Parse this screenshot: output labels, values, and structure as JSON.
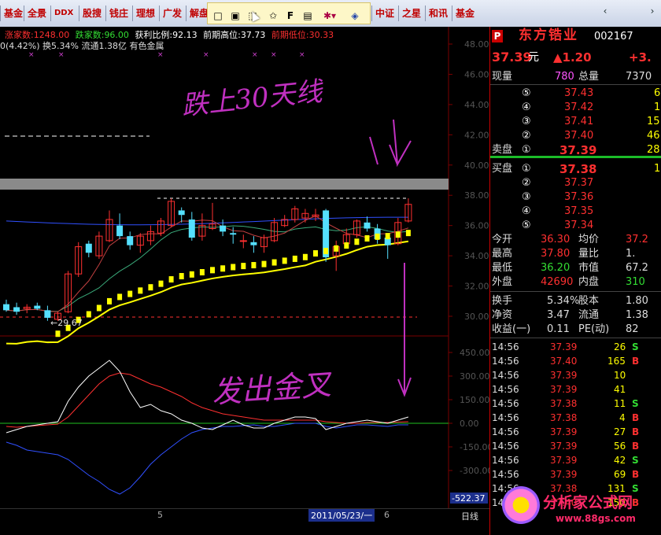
{
  "toolbar": {
    "tabs": [
      "基金",
      "全景",
      "DDX",
      "股搜",
      "钱庄",
      "理想",
      "广发",
      "解盘",
      "中证",
      "之星",
      "和讯",
      "基金"
    ]
  },
  "stats": {
    "up_count_label": "涨家数:",
    "up_count": "1248.00",
    "down_count_label": "跌家数:",
    "down_count": "96.00",
    "profit_ratio_label": "获利比例:",
    "profit_ratio": "92.13",
    "prev_high_label": "前期高位:",
    "prev_high": "37.73",
    "prev_low_label": "前期低位:",
    "prev_low": "30.33",
    "line2": "0(4.42%) 换5.34% 流通1.38亿 有色金属"
  },
  "chart": {
    "price_ticks": [
      "48.00",
      "46.00",
      "44.00",
      "42.00",
      "40.00",
      "38.00",
      "36.00",
      "34.00",
      "32.00",
      "30.00"
    ],
    "indicator_ticks": [
      "450.00",
      "300.00",
      "150.00",
      "0.00",
      "-150.00",
      "-300.00"
    ],
    "low_marker": "←29.67",
    "bottom_value": "-522.37",
    "date_label": "2011/05/23/一",
    "day_line": "日线",
    "month_marks": [
      "5",
      "6"
    ],
    "handwriting_top": "跌上30天线",
    "handwriting_bottom": "发出金叉",
    "colors": {
      "up": "#ff3030",
      "down": "#55e0ff",
      "ma_yellow": "#ffff00"
    }
  },
  "chart_data": {
    "type": "candlestick",
    "candles": [
      {
        "o": 30.8,
        "h": 31.1,
        "l": 30.3,
        "c": 30.4
      },
      {
        "o": 30.6,
        "h": 30.9,
        "l": 30.1,
        "c": 30.3
      },
      {
        "o": 30.5,
        "h": 30.8,
        "l": 30.2,
        "c": 30.6
      },
      {
        "o": 30.7,
        "h": 30.9,
        "l": 30.4,
        "c": 30.5
      },
      {
        "o": 30.4,
        "h": 30.7,
        "l": 29.7,
        "c": 29.9
      },
      {
        "o": 29.8,
        "h": 30.3,
        "l": 29.7,
        "c": 30.2
      },
      {
        "o": 30.3,
        "h": 33.0,
        "l": 30.2,
        "c": 32.8
      },
      {
        "o": 32.8,
        "h": 34.9,
        "l": 32.6,
        "c": 34.6
      },
      {
        "o": 34.8,
        "h": 35.0,
        "l": 33.9,
        "c": 34.2
      },
      {
        "o": 34.0,
        "h": 35.6,
        "l": 33.8,
        "c": 35.3
      },
      {
        "o": 35.0,
        "h": 37.0,
        "l": 34.9,
        "c": 36.4
      },
      {
        "o": 36.0,
        "h": 36.8,
        "l": 35.1,
        "c": 35.3
      },
      {
        "o": 35.3,
        "h": 35.6,
        "l": 34.4,
        "c": 34.7
      },
      {
        "o": 34.7,
        "h": 35.5,
        "l": 34.2,
        "c": 35.3
      },
      {
        "o": 35.0,
        "h": 36.0,
        "l": 34.7,
        "c": 35.6
      },
      {
        "o": 35.5,
        "h": 36.5,
        "l": 35.3,
        "c": 36.3
      },
      {
        "o": 36.0,
        "h": 37.8,
        "l": 35.9,
        "c": 37.6
      },
      {
        "o": 37.0,
        "h": 37.2,
        "l": 36.2,
        "c": 36.7
      },
      {
        "o": 36.4,
        "h": 36.9,
        "l": 35.0,
        "c": 35.2
      },
      {
        "o": 35.3,
        "h": 36.8,
        "l": 35.0,
        "c": 36.0
      },
      {
        "o": 35.8,
        "h": 37.5,
        "l": 35.7,
        "c": 36.1
      },
      {
        "o": 36.0,
        "h": 36.4,
        "l": 35.3,
        "c": 35.6
      },
      {
        "o": 35.5,
        "h": 35.9,
        "l": 34.8,
        "c": 35.4
      },
      {
        "o": 35.0,
        "h": 35.4,
        "l": 34.5,
        "c": 35.0
      },
      {
        "o": 34.9,
        "h": 35.3,
        "l": 34.2,
        "c": 34.7
      },
      {
        "o": 34.6,
        "h": 35.4,
        "l": 34.2,
        "c": 35.2
      },
      {
        "o": 35.0,
        "h": 36.5,
        "l": 34.9,
        "c": 36.2
      },
      {
        "o": 36.0,
        "h": 36.7,
        "l": 35.9,
        "c": 36.4
      },
      {
        "o": 36.4,
        "h": 37.3,
        "l": 36.2,
        "c": 37.1
      },
      {
        "o": 36.5,
        "h": 37.1,
        "l": 36.2,
        "c": 36.8
      },
      {
        "o": 36.6,
        "h": 37.1,
        "l": 36.3,
        "c": 36.7
      },
      {
        "o": 37.0,
        "h": 37.1,
        "l": 33.6,
        "c": 33.9
      },
      {
        "o": 34.0,
        "h": 35.0,
        "l": 33.0,
        "c": 34.6
      },
      {
        "o": 34.8,
        "h": 35.8,
        "l": 34.6,
        "c": 35.4
      },
      {
        "o": 35.4,
        "h": 36.4,
        "l": 35.2,
        "c": 36.3
      },
      {
        "o": 36.2,
        "h": 36.6,
        "l": 35.6,
        "c": 35.8
      },
      {
        "o": 35.8,
        "h": 36.1,
        "l": 34.8,
        "c": 35.1
      },
      {
        "o": 35.2,
        "h": 35.5,
        "l": 33.8,
        "c": 34.7
      },
      {
        "o": 34.8,
        "h": 36.5,
        "l": 34.7,
        "c": 36.2
      },
      {
        "o": 36.3,
        "h": 37.8,
        "l": 36.2,
        "c": 37.4
      }
    ],
    "indicator": {
      "white": [
        -60,
        -40,
        -20,
        -10,
        0,
        10,
        140,
        230,
        300,
        350,
        400,
        330,
        200,
        100,
        120,
        80,
        60,
        20,
        0,
        -30,
        -40,
        -10,
        20,
        -10,
        -30,
        -30,
        0,
        20,
        40,
        40,
        30,
        -40,
        -20,
        0,
        10,
        20,
        10,
        0,
        20,
        40
      ],
      "red": [
        -20,
        -25,
        -20,
        -15,
        -10,
        -5,
        40,
        110,
        180,
        250,
        300,
        320,
        310,
        280,
        250,
        230,
        200,
        170,
        130,
        100,
        80,
        60,
        50,
        40,
        30,
        20,
        20,
        20,
        20,
        20,
        20,
        10,
        5,
        0,
        0,
        5,
        5,
        5,
        8,
        10
      ],
      "blue": [
        -120,
        -140,
        -170,
        -180,
        -190,
        -200,
        -230,
        -280,
        -330,
        -370,
        -420,
        -450,
        -410,
        -340,
        -260,
        -200,
        -150,
        -100,
        -60,
        -40,
        -30,
        -20,
        -20,
        -15,
        -10,
        -20,
        -20,
        -10,
        0,
        0,
        0,
        -20,
        -30,
        -20,
        -10,
        -10,
        -15,
        -20,
        -10,
        -10
      ]
    }
  },
  "quote": {
    "p_badge": "P",
    "name": "东方锆业",
    "code": "002167",
    "price": "37.39",
    "price_unit": "元",
    "change": "▲1.20",
    "change_pct": "+3.",
    "vol_now_label": "现量",
    "vol_now": "780",
    "vol_total_label": "总量",
    "vol_total": "7370",
    "asks": [
      {
        "lvl": "⑤",
        "price": "37.43",
        "qty": "6"
      },
      {
        "lvl": "④",
        "price": "37.42",
        "qty": "1"
      },
      {
        "lvl": "③",
        "price": "37.41",
        "qty": "15"
      },
      {
        "lvl": "②",
        "price": "37.40",
        "qty": "46"
      },
      {
        "lvl": "①",
        "price": "37.39",
        "qty": "28"
      }
    ],
    "ask_label": "卖盘",
    "bid_label": "买盘",
    "bids": [
      {
        "lvl": "①",
        "price": "37.38",
        "qty": "1"
      },
      {
        "lvl": "②",
        "price": "37.37",
        "qty": ""
      },
      {
        "lvl": "③",
        "price": "37.36",
        "qty": ""
      },
      {
        "lvl": "④",
        "price": "37.35",
        "qty": ""
      },
      {
        "lvl": "⑤",
        "price": "37.34",
        "qty": ""
      }
    ],
    "stats1": [
      {
        "l": "今开",
        "v": "36.30",
        "l2": "均价",
        "v2": "37.2"
      },
      {
        "l": "最高",
        "v": "37.80",
        "l2": "量比",
        "v2": "1."
      },
      {
        "l": "最低",
        "v": "36.20",
        "l2": "市值",
        "v2": "67.2"
      },
      {
        "l": "外盘",
        "v": "42690",
        "l2": "内盘",
        "v2": "310"
      }
    ],
    "stats2": [
      {
        "l": "换手",
        "v": "5.34%",
        "l2": "股本",
        "v2": "1.80"
      },
      {
        "l": "净资",
        "v": "3.47",
        "l2": "流通",
        "v2": "1.38"
      },
      {
        "l": "收益(一)",
        "v": "0.11",
        "l2": "PE(动)",
        "v2": "82"
      }
    ],
    "ticks": [
      {
        "t": "14:56",
        "p": "37.39",
        "q": "26",
        "s": "S",
        "pc": "#ff3030",
        "sc": "#33dd33"
      },
      {
        "t": "14:56",
        "p": "37.40",
        "q": "165",
        "s": "B",
        "pc": "#ff3030",
        "sc": "#ff3030"
      },
      {
        "t": "14:56",
        "p": "37.39",
        "q": "10",
        "s": "",
        "pc": "#ff3030",
        "sc": "#ffffff"
      },
      {
        "t": "14:56",
        "p": "37.39",
        "q": "41",
        "s": "",
        "pc": "#ff3030",
        "sc": "#ffffff"
      },
      {
        "t": "14:56",
        "p": "37.38",
        "q": "11",
        "s": "S",
        "pc": "#ff3030",
        "sc": "#33dd33"
      },
      {
        "t": "14:56",
        "p": "37.38",
        "q": "4",
        "s": "B",
        "pc": "#ff3030",
        "sc": "#ff3030"
      },
      {
        "t": "14:56",
        "p": "37.39",
        "q": "27",
        "s": "B",
        "pc": "#ff3030",
        "sc": "#ff3030"
      },
      {
        "t": "14:56",
        "p": "37.39",
        "q": "56",
        "s": "B",
        "pc": "#ff3030",
        "sc": "#ff3030"
      },
      {
        "t": "14:56",
        "p": "37.39",
        "q": "42",
        "s": "S",
        "pc": "#ff3030",
        "sc": "#33dd33"
      },
      {
        "t": "14:56",
        "p": "37.39",
        "q": "69",
        "s": "B",
        "pc": "#ff3030",
        "sc": "#ff3030"
      },
      {
        "t": "14:56",
        "p": "37.38",
        "q": "131",
        "s": "S",
        "pc": "#ff3030",
        "sc": "#33dd33"
      },
      {
        "t": "14:56",
        "p": "37.40",
        "q": "150",
        "s": "B",
        "pc": "#ff3030",
        "sc": "#ff3030"
      }
    ]
  },
  "watermark": {
    "title": "分析家公式网",
    "url": "www.88gs.com"
  }
}
